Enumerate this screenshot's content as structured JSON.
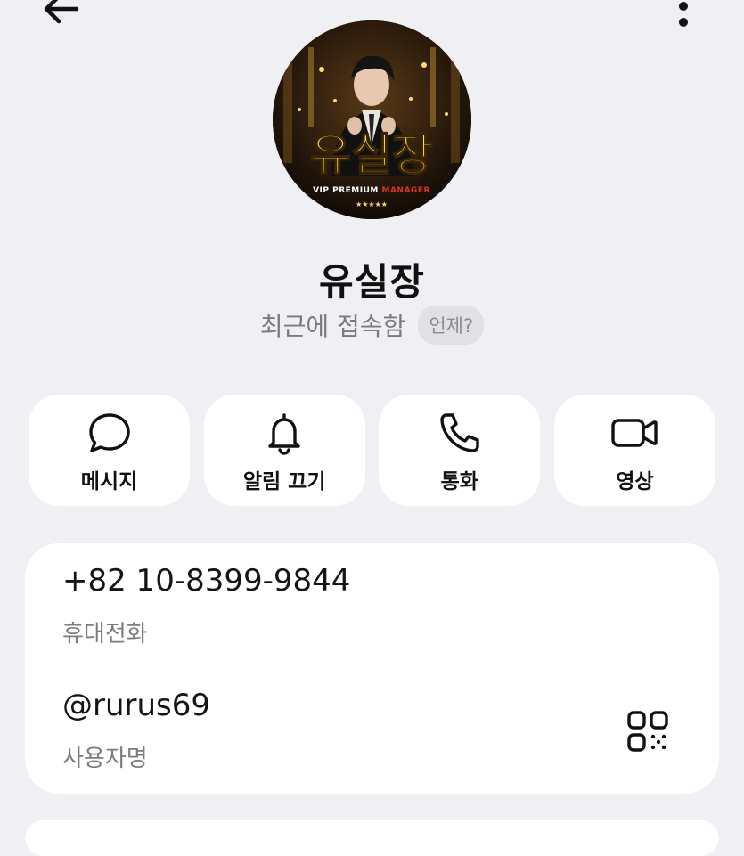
{
  "header": {
    "back_icon": "arrow-left-icon",
    "more_icon": "more-vertical-icon"
  },
  "profile": {
    "name": "유실장",
    "last_seen": "최근에 접속함",
    "when_chip": "언제?",
    "avatar": {
      "title_text": "유실장",
      "banner_text": "VIP PREMIUM",
      "banner_highlight": "MANAGER",
      "stars": "★★★★★"
    }
  },
  "actions": [
    {
      "label": "메시지",
      "icon": "message-bubble-icon"
    },
    {
      "label": "알림 끄기",
      "icon": "bell-icon"
    },
    {
      "label": "통화",
      "icon": "phone-icon"
    },
    {
      "label": "영상",
      "icon": "video-camera-icon"
    }
  ],
  "info": {
    "phone": "+82 10-8399-9844",
    "phone_label": "휴대전화",
    "username": "@rurus69",
    "username_label": "사용자명",
    "qr_icon": "qr-code-icon"
  },
  "colors": {
    "background": "#efeff4",
    "card": "#ffffff",
    "secondary_text": "#7a7a7f",
    "avatar_gold": "#e8c04a"
  }
}
